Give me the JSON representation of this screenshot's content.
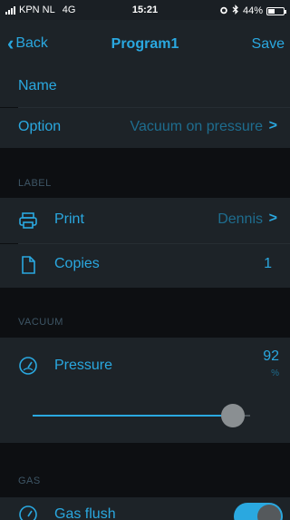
{
  "status_bar": {
    "carrier": "KPN NL",
    "network": "4G",
    "time": "15:21",
    "battery_percent": "44%",
    "battery_level": 0.44
  },
  "nav": {
    "back_label": "Back",
    "title": "Program1",
    "save_label": "Save"
  },
  "general": {
    "name_label": "Name",
    "option_label": "Option",
    "option_value": "Vacuum on pressure"
  },
  "label_section": {
    "header": "LABEL",
    "print_label": "Print",
    "print_value": "Dennis",
    "copies_label": "Copies",
    "copies_value": "1"
  },
  "vacuum_section": {
    "header": "VACUUM",
    "pressure_label": "Pressure",
    "pressure_value": "92",
    "pressure_unit": "%",
    "pressure_fraction": 0.92
  },
  "gas_section": {
    "header": "GAS",
    "gas_flush_label": "Gas flush",
    "gas_flush_on": true
  },
  "colors": {
    "accent": "#2aa8e0",
    "background": "#0d0f12",
    "row": "#1d2328"
  }
}
